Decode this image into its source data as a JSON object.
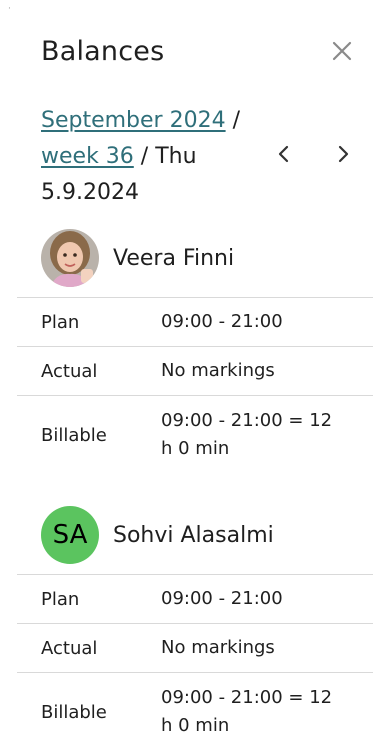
{
  "corner_mark": "·",
  "header": {
    "title": "Balances"
  },
  "breadcrumb": {
    "month_year": "September 2024",
    "separator1": " / ",
    "week": "week 36",
    "separator2": " / ",
    "day": "Thu 5.9.2024"
  },
  "icons": {
    "close": "close-icon",
    "prev": "chevron-left-icon",
    "next": "chevron-right-icon"
  },
  "colors": {
    "link": "#2f6f7a",
    "initials_avatar": "#5bc45f",
    "divider": "#d9d9d9"
  },
  "children": [
    {
      "name": "Veera Finni",
      "avatar": "photo",
      "rows": [
        {
          "label": "Plan",
          "value": "09:00 - 21:00"
        },
        {
          "label": "Actual",
          "value": "No markings"
        },
        {
          "label": "Billable",
          "value": "09:00 - 21:00  = 12 h 0 min"
        }
      ]
    },
    {
      "name": "Sohvi Alasalmi",
      "initials": "SA",
      "rows": [
        {
          "label": "Plan",
          "value": "09:00 - 21:00"
        },
        {
          "label": "Actual",
          "value": "No markings"
        },
        {
          "label": "Billable",
          "value": "09:00 - 21:00  = 12 h 0 min"
        }
      ]
    }
  ]
}
